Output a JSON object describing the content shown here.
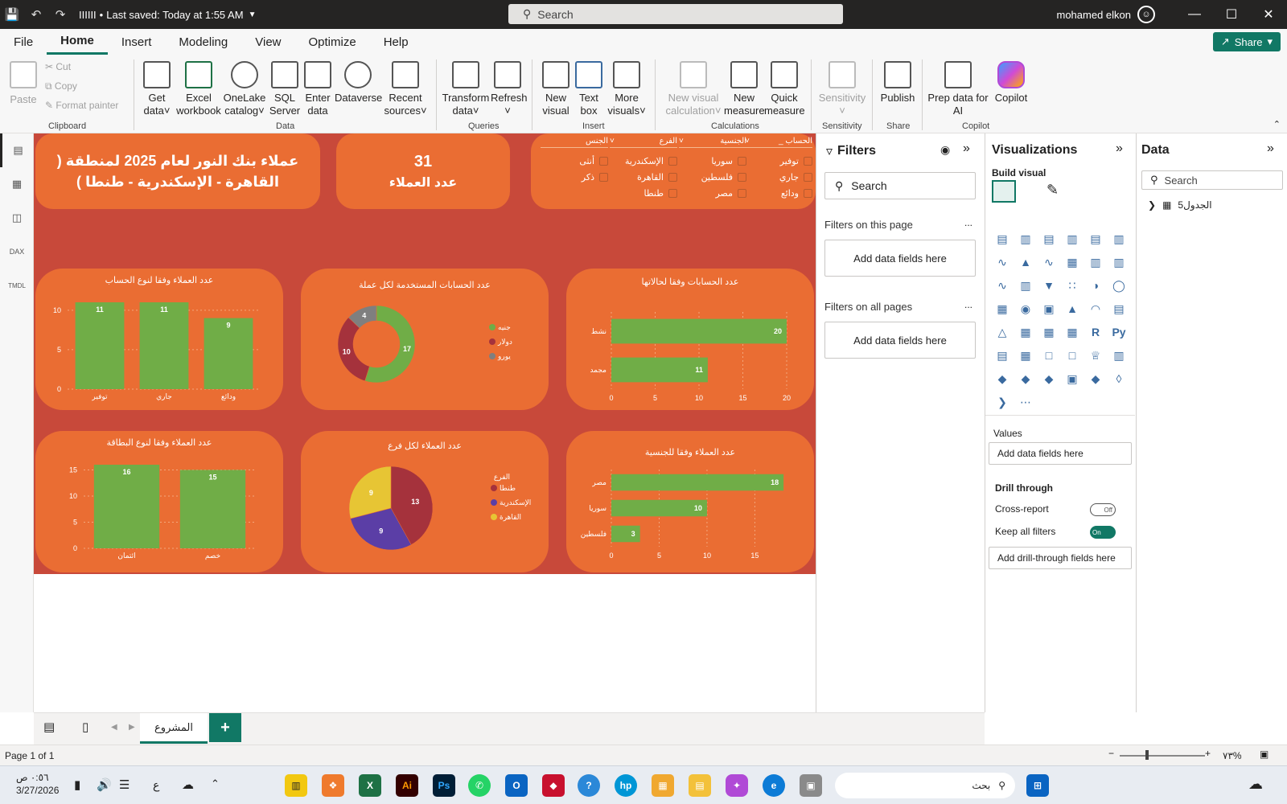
{
  "titlebar": {
    "file_name": "IIIIII",
    "saved": "Last saved: Today at 1:55 AM",
    "search": "Search",
    "user": "mohamed elkon"
  },
  "menu": [
    "File",
    "Home",
    "Insert",
    "Modeling",
    "View",
    "Optimize",
    "Help"
  ],
  "share": "Share",
  "ribbon": {
    "clipboard": {
      "paste": "Paste",
      "cut": "Cut",
      "copy": "Copy",
      "format_painter": "Format painter",
      "group": "Clipboard"
    },
    "data": {
      "get_data": [
        "Get",
        "data"
      ],
      "excel": [
        "Excel",
        "workbook"
      ],
      "onelake": [
        "OneLake",
        "catalog"
      ],
      "sql": [
        "SQL",
        "Server"
      ],
      "enter": [
        "Enter",
        "data"
      ],
      "dataverse": [
        "Dataverse",
        ""
      ],
      "recent": [
        "Recent",
        "sources"
      ],
      "group": "Data"
    },
    "queries": {
      "transform": [
        "Transform",
        "data"
      ],
      "refresh": [
        "Refresh",
        ""
      ],
      "group": "Queries"
    },
    "insert": {
      "new_visual": [
        "New",
        "visual"
      ],
      "text_box": [
        "Text",
        "box"
      ],
      "more": [
        "More",
        "visuals"
      ],
      "group": "Insert"
    },
    "calculations": {
      "new_visual_calc": [
        "New visual",
        "calculation"
      ],
      "new_measure": [
        "New",
        "measure"
      ],
      "quick_measure": [
        "Quick",
        "measure"
      ],
      "group": "Calculations"
    },
    "sensitivity": {
      "label": "Sensitivity",
      "group": "Sensitivity"
    },
    "share": {
      "publish": "Publish",
      "group": "Share"
    },
    "copilot": {
      "prep": [
        "Prep data for",
        "AI"
      ],
      "copilot": "Copilot",
      "group": "Copilot"
    }
  },
  "report": {
    "title": "عملاء بنك النور لعام 2025 لمنطقة ( القاهرة - الإسكندرية - طنطا )",
    "kpi_value": "31",
    "kpi_label": "عدد العملاء",
    "slicers": [
      {
        "header": "الجنس",
        "items": [
          "أنثى",
          "ذكر"
        ]
      },
      {
        "header": "الفرع",
        "items": [
          "الإسكندرية",
          "القاهرة",
          "طنطا"
        ]
      },
      {
        "header": "الجنسية",
        "items": [
          "سوريا",
          "فلسطين",
          "مصر"
        ]
      },
      {
        "header": "_ الحساب",
        "items": [
          "توفير",
          "جاري",
          "ودائع"
        ]
      }
    ]
  },
  "chart_data": [
    {
      "type": "bar",
      "title": "عدد العملاء وفقا لنوع الحساب",
      "categories": [
        "توفير",
        "جاري",
        "ودائع"
      ],
      "values": [
        11,
        11,
        9
      ],
      "yticks": [
        0,
        5,
        10
      ],
      "ylim": [
        0,
        11
      ],
      "color": "#70ad47"
    },
    {
      "type": "pie",
      "variant": "donut",
      "title": "عدد الحسابات المستخدمة لكل عملة",
      "categories": [
        "جنيه",
        "دولار",
        "يورو"
      ],
      "values": [
        17,
        10,
        4
      ],
      "colors": [
        "#70ad47",
        "#a5323c",
        "#7f7f7f"
      ]
    },
    {
      "type": "bar",
      "orientation": "horizontal",
      "title": "عدد الحسابات وفقا لحالاتها",
      "categories": [
        "نشط",
        "مجمد"
      ],
      "values": [
        20,
        11
      ],
      "xticks": [
        0,
        5,
        10,
        15,
        20
      ],
      "xlim": [
        0,
        20
      ],
      "color": "#70ad47"
    },
    {
      "type": "bar",
      "title": "عدد العملاء وفقا لنوع البطاقة",
      "categories": [
        "ائتمان",
        "خصم"
      ],
      "values": [
        16,
        15
      ],
      "yticks": [
        0,
        5,
        10,
        15
      ],
      "ylim": [
        0,
        16
      ],
      "color": "#70ad47"
    },
    {
      "type": "pie",
      "title": "عدد العملاء لكل فرع",
      "legend_title": "الفرع",
      "categories": [
        "طنطا",
        "الإسكندرية",
        "القاهرة"
      ],
      "values": [
        13,
        9,
        9
      ],
      "colors": [
        "#a5323c",
        "#5b3ea6",
        "#e7c534"
      ]
    },
    {
      "type": "bar",
      "orientation": "horizontal",
      "title": "عدد العملاء وفقا للجنسية",
      "categories": [
        "مصر",
        "سوريا",
        "فلسطين"
      ],
      "values": [
        18,
        10,
        3
      ],
      "xticks": [
        0,
        5,
        10,
        15
      ],
      "xlim": [
        0,
        19
      ],
      "color": "#70ad47"
    }
  ],
  "filters": {
    "title": "Filters",
    "search": "Search",
    "on_page": "Filters on this page",
    "on_all": "Filters on all pages",
    "add": "Add data fields here",
    "more": "..."
  },
  "viz": {
    "title": "Visualizations",
    "build": "Build visual",
    "values": "Values",
    "add": "Add data fields here",
    "drill": "Drill through",
    "cross": "Cross-report",
    "cross_state": "Off",
    "keep": "Keep all filters",
    "keep_state": "On",
    "add_drill": "Add drill-through fields here"
  },
  "datapane": {
    "title": "Data",
    "search": "Search",
    "table": "الجدول5"
  },
  "tabs": {
    "page": "المشروع"
  },
  "status": {
    "page": "Page 1 of 1",
    "zoom": "٧٣%"
  },
  "taskbar": {
    "time": "٠:٥٦ ص",
    "date": "3/27/2026",
    "lang": "ع",
    "search": "بحث"
  }
}
